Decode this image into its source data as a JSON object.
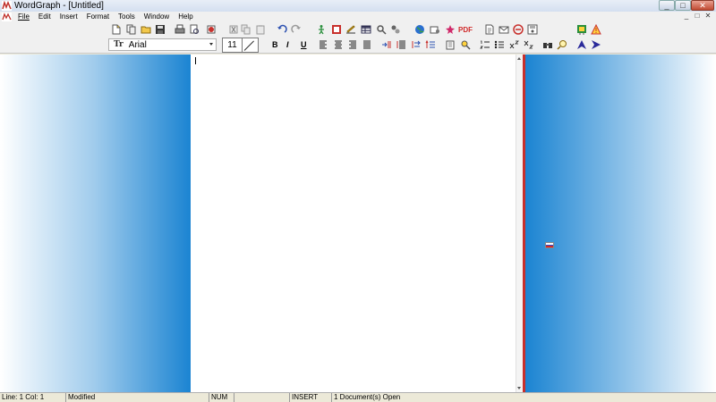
{
  "window": {
    "title": "WordGraph - [Untitled]",
    "controls": [
      "_",
      "□",
      "✕"
    ]
  },
  "menu": {
    "items": [
      {
        "label": "File",
        "mnemonic": "F"
      },
      {
        "label": "Edit",
        "mnemonic": "E"
      },
      {
        "label": "Insert",
        "mnemonic": "I"
      },
      {
        "label": "Format",
        "mnemonic": "o"
      },
      {
        "label": "Tools",
        "mnemonic": "T"
      },
      {
        "label": "Window",
        "mnemonic": "W"
      },
      {
        "label": "Help",
        "mnemonic": "H"
      }
    ],
    "mdi_controls": [
      "_",
      "□",
      "✕"
    ]
  },
  "toolbar1": {
    "icons": [
      "new-document-icon",
      "copy-document-icon",
      "open-folder-icon",
      "save-icon",
      "virus-scan-icon",
      "print-icon",
      "print-preview-icon",
      "export-icon",
      "cut-icon",
      "copy-icon",
      "paste-icon",
      "undo-icon",
      "redo-icon",
      "insert-person-icon",
      "insert-image-icon",
      "insert-pen-icon",
      "insert-table-icon",
      "insert-symbol-icon",
      "globe-icon",
      "printer-gear-icon",
      "star-icon",
      "pdf-icon",
      "page-icon",
      "email-icon",
      "stop-icon",
      "save-disk-icon",
      "help-icon",
      "warning-icon"
    ],
    "pdf_label": "PDF"
  },
  "toolbar2": {
    "font_name": "Arial",
    "font_size": "11",
    "format_letters": {
      "bold": "B",
      "italic": "I",
      "underline": "U"
    },
    "icons": [
      "align-left-icon",
      "align-center-icon",
      "align-right-icon",
      "justify-icon",
      "indent-icon",
      "outdent-icon",
      "swap-icon",
      "sort-icon",
      "paragraph-icon",
      "spellcheck-icon",
      "numbered-list-icon",
      "bulleted-list-icon",
      "superscript-icon",
      "subscript-icon",
      "find-icon",
      "zoom-icon",
      "arrow-up-icon",
      "arrow-right-icon"
    ]
  },
  "colors": {
    "accent_blue": "#1b84d2",
    "splitter_red": "#c8302c",
    "chrome_gray": "#f0f0f0"
  },
  "statusbar": {
    "line_col": "Line:  1  Col:  1",
    "modified": "Modified",
    "num": "NUM",
    "insert": "INSERT",
    "docs": "1 Document(s) Open"
  }
}
